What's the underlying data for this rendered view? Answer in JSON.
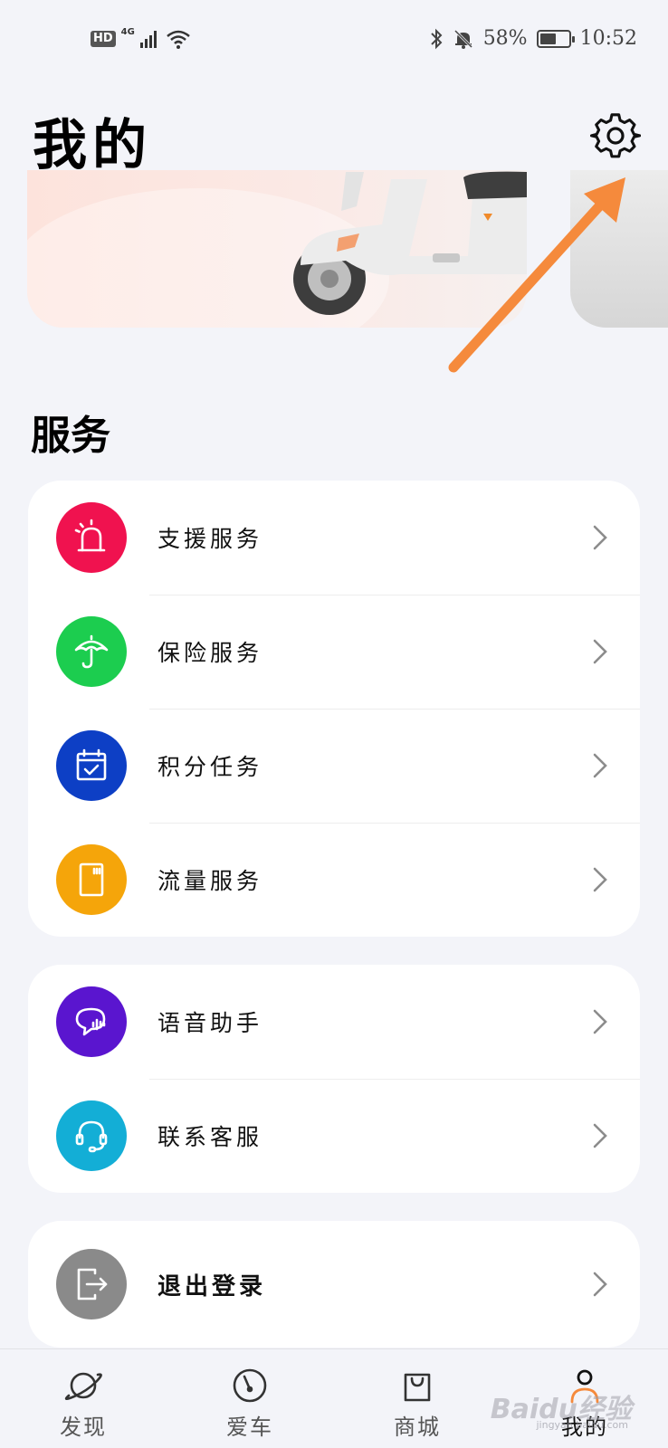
{
  "status_bar": {
    "hd": "HD",
    "network": "4G",
    "battery_percent": "58%",
    "battery_level": 0.58,
    "time": "10:52"
  },
  "header": {
    "title": "我的"
  },
  "services": {
    "title": "服务",
    "items": [
      {
        "label": "支援服务",
        "icon": "alarm-light-icon",
        "color": "#f0124f"
      },
      {
        "label": "保险服务",
        "icon": "umbrella-icon",
        "color": "#1ccd4f"
      },
      {
        "label": "积分任务",
        "icon": "calendar-check-icon",
        "color": "#0d3fc5"
      },
      {
        "label": "流量服务",
        "icon": "sim-card-icon",
        "color": "#f5a50a"
      }
    ]
  },
  "support": {
    "items": [
      {
        "label": "语音助手",
        "icon": "voice-chat-icon",
        "color": "#5a15cf"
      },
      {
        "label": "联系客服",
        "icon": "headset-icon",
        "color": "#13aed6"
      }
    ]
  },
  "logout": {
    "label": "退出登录",
    "icon": "logout-icon",
    "color": "#8a8a8a"
  },
  "bottom_nav": {
    "items": [
      {
        "label": "发现",
        "icon": "planet-icon"
      },
      {
        "label": "爱车",
        "icon": "speedometer-icon"
      },
      {
        "label": "商城",
        "icon": "shopping-bag-icon"
      },
      {
        "label": "我的",
        "icon": "user-icon",
        "active": true
      }
    ]
  },
  "watermark": {
    "text": "Baidu经验",
    "sub": "jingyan.baidu.com"
  }
}
